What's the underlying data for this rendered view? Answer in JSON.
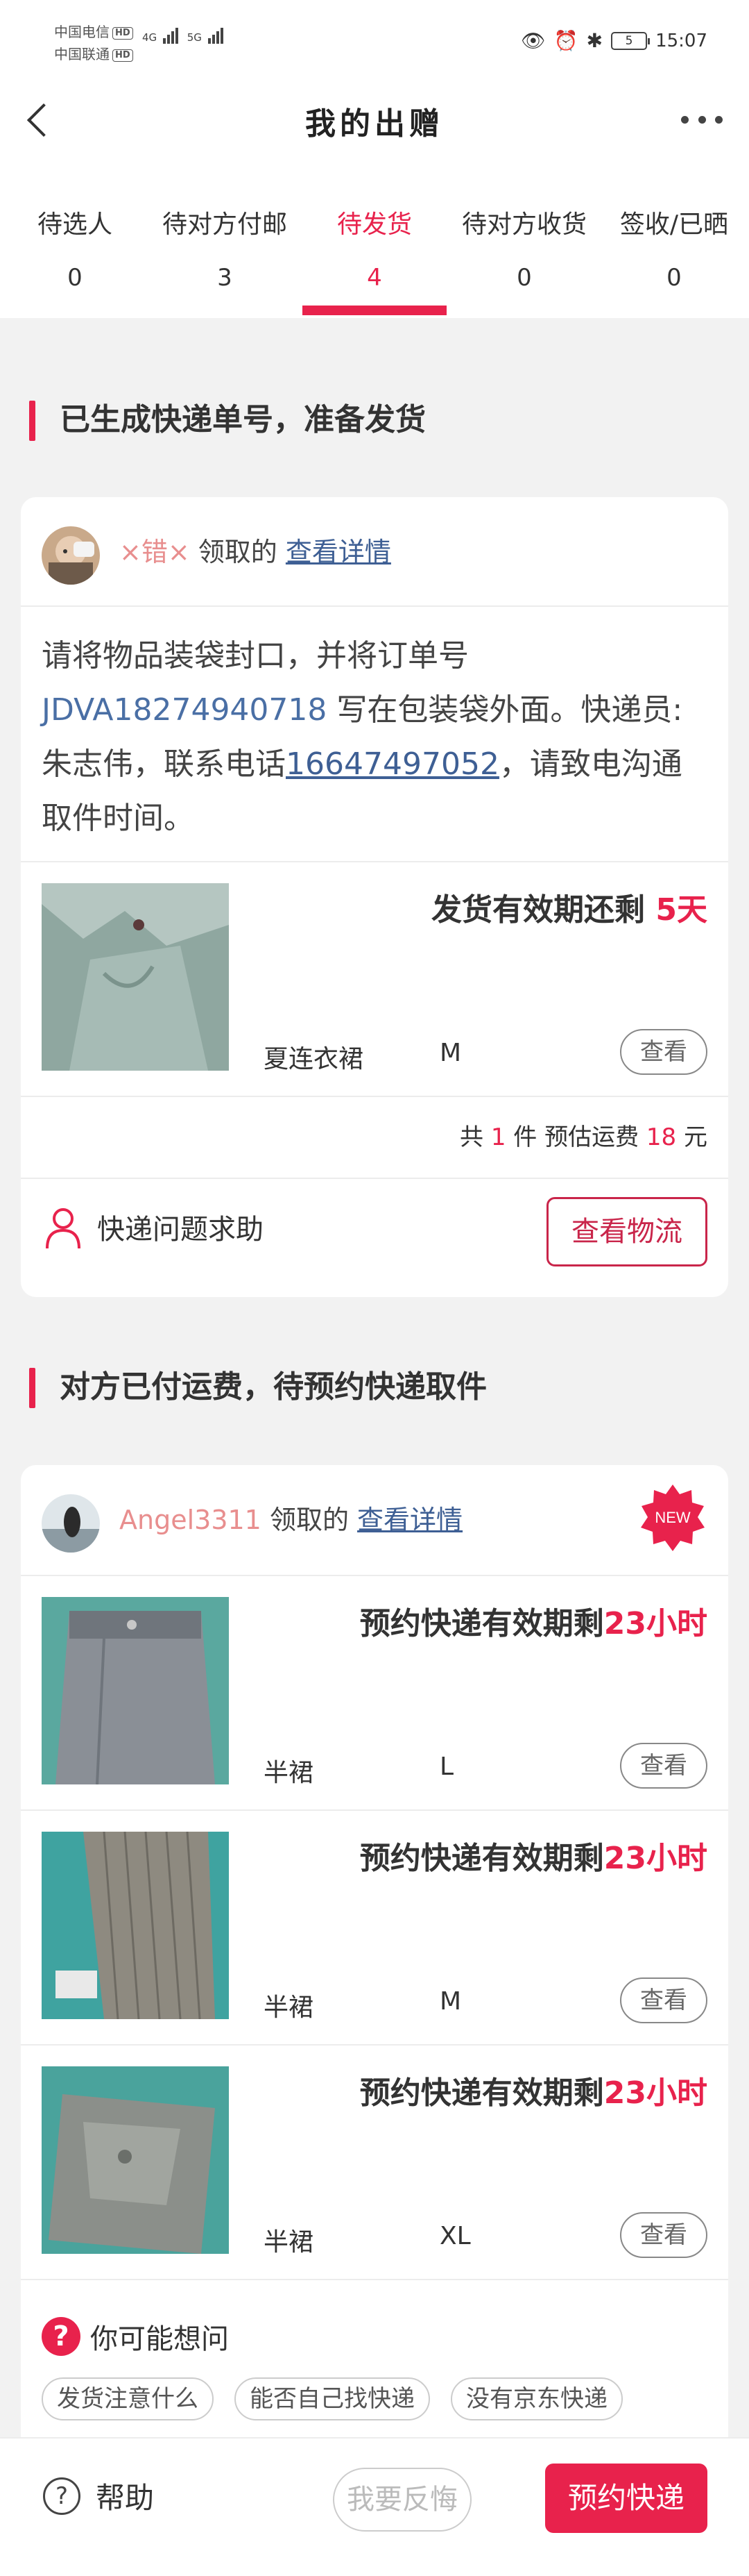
{
  "status_bar": {
    "carrier1": "中国电信",
    "carrier2": "中国联通",
    "hd": "HD",
    "net1": "4G",
    "net2": "5G",
    "battery": "5",
    "time": "15:07"
  },
  "header": {
    "title": "我的出赠"
  },
  "tabs": [
    {
      "label": "待选人",
      "count": "0"
    },
    {
      "label": "待对方付邮",
      "count": "3"
    },
    {
      "label": "待发货",
      "count": "4"
    },
    {
      "label": "待对方收货",
      "count": "0"
    },
    {
      "label": "签收/已晒",
      "count": "0"
    }
  ],
  "section1": {
    "title": "已生成快递单号，准备发货",
    "card": {
      "username": "×错×",
      "claim_suffix": "领取的",
      "details_link": "查看详情",
      "instr_before": "请将物品装袋封口，并将订单号 ",
      "order_no": "JDVA18274940718",
      "instr_middle": " 写在包装袋外面。快递员:朱志伟，联系电话",
      "phone": "16647497052",
      "instr_after": "，请致电沟通取件时间。",
      "deadline_label": "发货有效期还剩 ",
      "deadline_value": "5天",
      "item": {
        "name": "夏连衣裙",
        "size": "M",
        "view": "查看"
      },
      "summary": {
        "prefix": "共 ",
        "count": "1",
        "middle": " 件 预估运费 ",
        "fee": "18",
        "suffix": " 元"
      },
      "help_text": "快递问题求助",
      "logistics_button": "查看物流"
    }
  },
  "section2": {
    "title": "对方已付运费，待预约快递取件",
    "card": {
      "username": "Angel3311",
      "claim_suffix": "领取的",
      "details_link": "查看详情",
      "new_badge": "NEW",
      "deadline_label": "预约快递有效期剩",
      "items": [
        {
          "name": "半裙",
          "size": "L",
          "deadline_value": "23小时",
          "view": "查看"
        },
        {
          "name": "半裙",
          "size": "M",
          "deadline_value": "23小时",
          "view": "查看"
        },
        {
          "name": "半裙",
          "size": "XL",
          "deadline_value": "23小时",
          "view": "查看"
        }
      ],
      "faq": {
        "icon": "?",
        "title": "你可能想问",
        "chips": [
          "发货注意什么",
          "能否自己找快递",
          "没有京东快递"
        ]
      }
    }
  },
  "bottom_bar": {
    "help_icon": "?",
    "help_label": "帮助",
    "feedback_button": "我要反悔",
    "book_button": "预约快递"
  },
  "colors": {
    "accent": "#e8224c",
    "link": "#3e5f94",
    "order_no": "#4a6fa5",
    "username": "#e88e8e"
  }
}
